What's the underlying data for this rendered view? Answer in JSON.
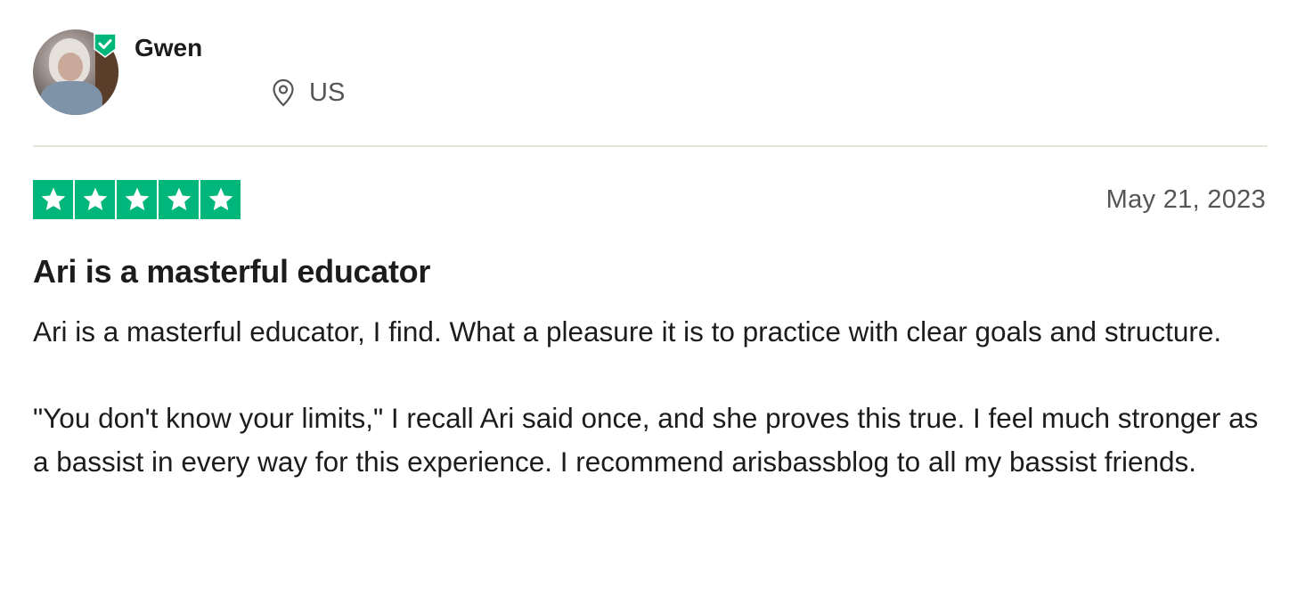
{
  "reviewer": {
    "name": "Gwen",
    "location": "US",
    "avatar_icon": "avatar-photo",
    "verified_icon": "verified-check-badge-icon"
  },
  "rating": {
    "stars": 5,
    "max_stars": 5,
    "star_color": "#00b67a",
    "star_icon": "star-icon"
  },
  "review": {
    "date": "May 21, 2023",
    "title": "Ari is a masterful educator",
    "paragraphs": [
      "Ari is a masterful educator, I find. What a pleasure it is to practice with clear goals and structure.",
      "\"You don't know your limits,\" I recall Ari said once, and she proves this true. I feel much stronger as a bassist in every way for this experience. I recommend arisbassblog to all my bassist friends."
    ]
  },
  "colors": {
    "accent_green": "#00b67a",
    "text_primary": "#1c1c1c",
    "text_secondary": "#555555",
    "divider": "#e5e5dd"
  }
}
